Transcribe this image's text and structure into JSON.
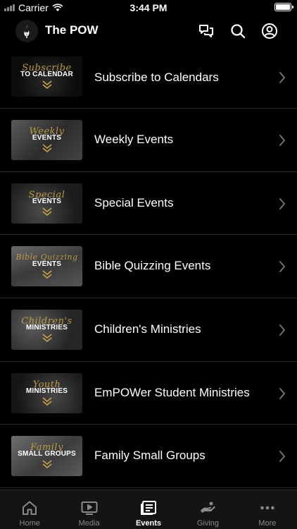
{
  "status_bar": {
    "carrier": "Carrier",
    "time": "3:44 PM"
  },
  "header": {
    "title": "The POW",
    "icons": [
      "chat-icon",
      "search-icon",
      "profile-icon"
    ]
  },
  "events": {
    "items": [
      {
        "label": "Subscribe to Calendars",
        "thumb_script": "Subscribe",
        "thumb_caption": "TO CALENDAR"
      },
      {
        "label": "Weekly Events",
        "thumb_script": "Weekly",
        "thumb_caption": "EVENTS"
      },
      {
        "label": "Special Events",
        "thumb_script": "Special",
        "thumb_caption": "EVENTS"
      },
      {
        "label": "Bible Quizzing Events",
        "thumb_script": "Bible Quizzing",
        "thumb_caption": "EVENTS"
      },
      {
        "label": "Children's Ministries",
        "thumb_script": "Children's",
        "thumb_caption": "MINISTRIES"
      },
      {
        "label": "EmPOWer Student Ministries",
        "thumb_script": "Youth",
        "thumb_caption": "MINISTRIES"
      },
      {
        "label": "Family Small Groups",
        "thumb_script": "Family",
        "thumb_caption": "SMALL GROUPS"
      }
    ]
  },
  "tabs": {
    "items": [
      {
        "label": "Home",
        "icon": "home-icon"
      },
      {
        "label": "Media",
        "icon": "media-icon"
      },
      {
        "label": "Events",
        "icon": "events-icon"
      },
      {
        "label": "Giving",
        "icon": "giving-icon"
      },
      {
        "label": "More",
        "icon": "more-icon"
      }
    ],
    "active": "Events"
  },
  "colors": {
    "background": "#000000",
    "accent_gold": "#c9a24a",
    "inactive_tab": "#8a8a8a"
  }
}
